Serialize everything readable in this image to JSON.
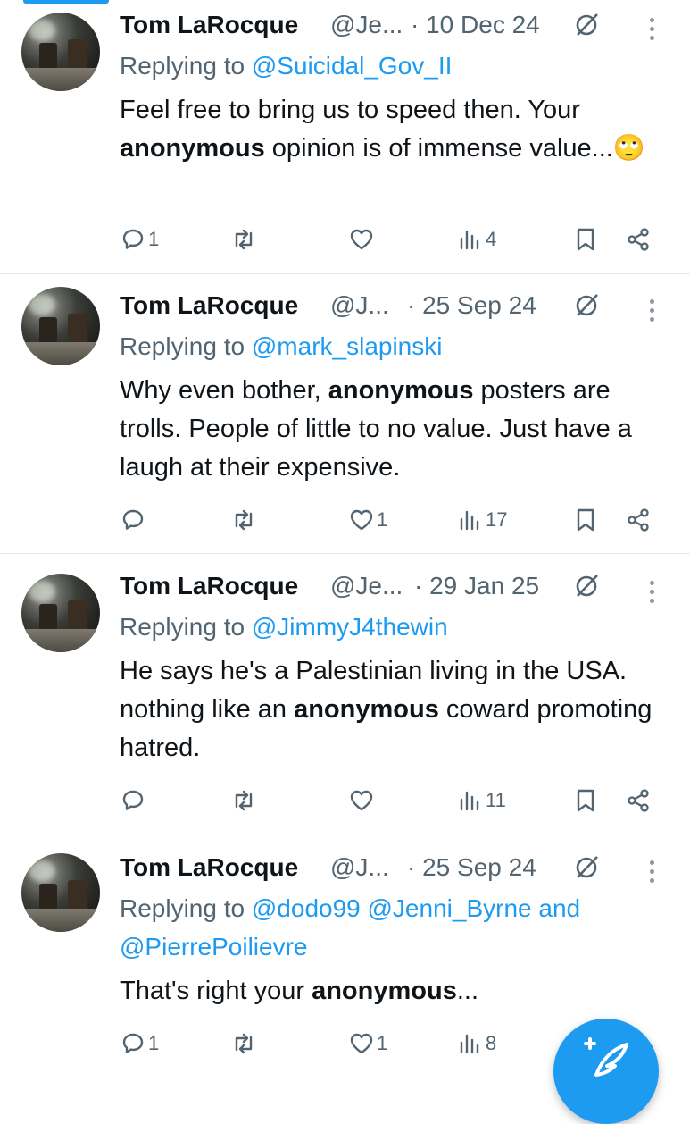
{
  "tweets": [
    {
      "name": "Tom LaRocque",
      "handle": "@Je...",
      "date": "· 10 Dec 24",
      "replying_prefix": "Replying to",
      "replying_to": "@Suicidal_Gov_II",
      "body_before": "Feel free to bring us to speed then.  Your",
      "body_bold": "anonymous",
      "body_after": " opinion is of immense value...🙄",
      "stats": {
        "replies": "1",
        "reposts": "",
        "likes": "",
        "views": "4"
      }
    },
    {
      "name": "Tom LaRocque",
      "handle": "@J...",
      "date": "· 25 Sep 24",
      "replying_prefix": "Replying to",
      "replying_to": "@mark_slapinski",
      "body_before": "Why even bother, ",
      "body_bold": "anonymous",
      "body_after": " posters are trolls. People of little to no value. Just have a laugh at their expensive.",
      "stats": {
        "replies": "",
        "reposts": "",
        "likes": "1",
        "views": "17"
      }
    },
    {
      "name": "Tom LaRocque",
      "handle": "@Je...",
      "date": "· 29 Jan 25",
      "replying_prefix": "Replying to",
      "replying_to": "@JimmyJ4thewin",
      "body_before": "He says he's a Palestinian living in the USA.  nothing like an ",
      "body_bold": "anonymous",
      "body_after": " coward promoting hatred.",
      "stats": {
        "replies": "",
        "reposts": "",
        "likes": "",
        "views": "11"
      }
    },
    {
      "name": "Tom LaRocque",
      "handle": "@J...",
      "date": "· 25 Sep 24",
      "replying_prefix": "Replying to",
      "replying_to": "@dodo99 @Jenni_Byrne and",
      "replying_to_2": "@PierrePoilievre",
      "body_before": "That's right your ",
      "body_bold": "anonymous",
      "body_after": "...",
      "stats": {
        "replies": "1",
        "reposts": "",
        "likes": "1",
        "views": "8"
      }
    }
  ],
  "icons": {
    "reply": "speech-bubble-icon",
    "repost": "repost-arrows-icon",
    "like": "heart-icon",
    "views": "bar-chart-icon",
    "bookmark": "bookmark-icon",
    "share": "share-nodes-icon",
    "grok": "grok-slash-icon",
    "more": "vertical-dots-icon",
    "compose": "compose-feather-plus-icon"
  },
  "colors": {
    "accent": "#1d9bf0",
    "muted": "#536471",
    "text": "#0f1419"
  }
}
